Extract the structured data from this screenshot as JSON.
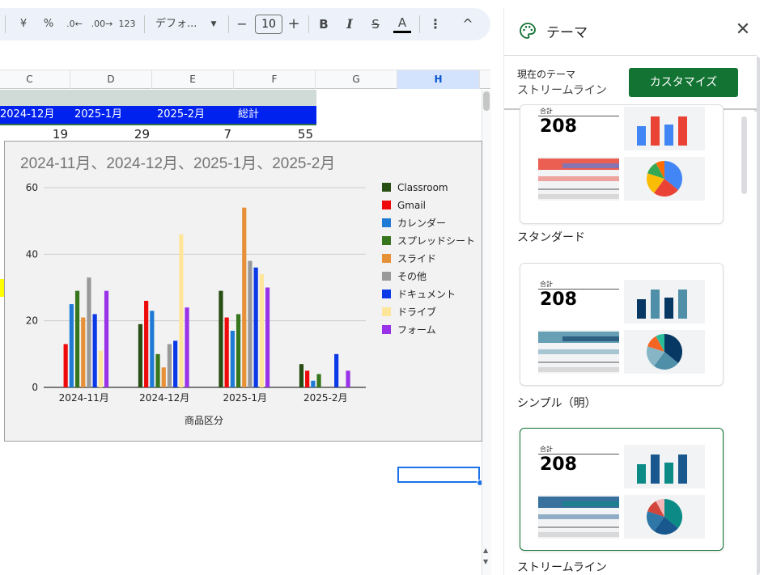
{
  "toolbar": {
    "currency": "¥",
    "percent": "%",
    "dec_decrease": ".0←",
    "dec_increase": ".00→",
    "number_format": "123",
    "font_name": "デフォ...",
    "font_size_minus": "−",
    "font_size": "10",
    "font_size_plus": "+",
    "bold": "B",
    "italic": "I",
    "strike": "S",
    "text_color": "A",
    "more": "⋮",
    "collapse": "^"
  },
  "sheet": {
    "columns": [
      "C",
      "D",
      "E",
      "F",
      "G",
      "H"
    ],
    "header_row": [
      "2024-12月",
      "2025-1月",
      "2025-2月",
      "総計"
    ],
    "totals_row": [
      "19",
      "29",
      "7",
      "55"
    ]
  },
  "chart_data": {
    "type": "bar",
    "title": "2024-11月、2024-12月、2025-1月、2025-2月",
    "xlabel": "商品区分",
    "ylabel": "",
    "ylim": [
      0,
      60
    ],
    "yticks": [
      0,
      20,
      40,
      60
    ],
    "categories": [
      "2024-11月",
      "2024-12月",
      "2025-1月",
      "2025-2月"
    ],
    "legend_position": "right",
    "series": [
      {
        "name": "Classroom",
        "color": "#274e13",
        "values": [
          0,
          19,
          29,
          7
        ]
      },
      {
        "name": "Gmail",
        "color": "#ee0a0a",
        "values": [
          13,
          26,
          21,
          5
        ]
      },
      {
        "name": "カレンダー",
        "color": "#1f7ad6",
        "values": [
          25,
          23,
          17,
          2
        ]
      },
      {
        "name": "スプレッドシート",
        "color": "#38761d",
        "values": [
          29,
          10,
          22,
          4
        ]
      },
      {
        "name": "スライド",
        "color": "#e69138",
        "values": [
          21,
          6,
          54,
          0
        ]
      },
      {
        "name": "その他",
        "color": "#999999",
        "values": [
          33,
          13,
          38,
          0
        ]
      },
      {
        "name": "ドキュメント",
        "color": "#0a3ae8",
        "values": [
          22,
          14,
          36,
          10
        ]
      },
      {
        "name": "ドライブ",
        "color": "#ffe599",
        "values": [
          11,
          46,
          34,
          0
        ]
      },
      {
        "name": "フォーム",
        "color": "#9932e8",
        "values": [
          29,
          24,
          30,
          5
        ]
      }
    ]
  },
  "panel": {
    "title": "テーマ",
    "current_label": "現在のテーマ",
    "current_name": "ストリームライン",
    "customize_label": "カスタマイズ",
    "themes": [
      {
        "name": "スタンダード",
        "kpi_label": "合計",
        "kpi_value": "208",
        "colors": [
          "#4285f4",
          "#ea4335",
          "#fbbc04",
          "#34a853",
          "#ff6d01"
        ]
      },
      {
        "name": "シンプル（明）",
        "kpi_label": "合計",
        "kpi_value": "208",
        "colors": [
          "#073763",
          "#4f8fa8",
          "#86b6c6",
          "#f46524",
          "#2bbd9a"
        ]
      },
      {
        "name": "ストリームライン",
        "kpi_label": "合計",
        "kpi_value": "208",
        "colors": [
          "#0b8a86",
          "#18588e",
          "#2e77a6",
          "#d1453b",
          "#f4b6b6"
        ]
      }
    ]
  }
}
